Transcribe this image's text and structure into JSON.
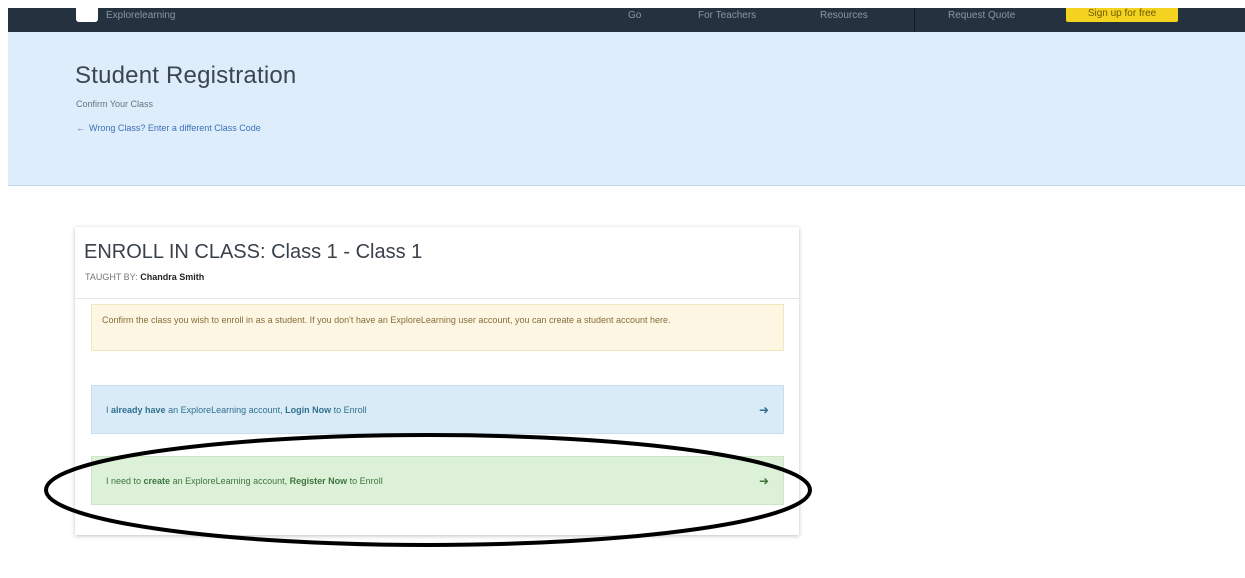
{
  "navbar": {
    "brand": "Explorelearning",
    "items": [
      "Go",
      "For Teachers",
      "Resources"
    ],
    "request_quote": "Request Quote",
    "cta": "Sign up for free"
  },
  "hero": {
    "title": "Student Registration",
    "subtitle": "Confirm Your Class",
    "back_link": "Wrong Class? Enter a different Class Code"
  },
  "card": {
    "title": "ENROLL IN CLASS: Class 1 - Class 1",
    "taught_by_label": "TAUGHT BY:",
    "teacher": "Chandra Smith",
    "notice": "Confirm the class you wish to enroll in as a student. If you don't have an ExploreLearning user account, you can create a student account here.",
    "login_option": {
      "pre": "I ",
      "bold1": "already have",
      "mid": " an ExploreLearning account, ",
      "bold2": "Login Now",
      "post": " to Enroll"
    },
    "register_option": {
      "pre": "I need to ",
      "bold1": "create",
      "mid": " an ExploreLearning account, ",
      "bold2": "Register Now",
      "post": " to Enroll"
    }
  },
  "colors": {
    "navbar": "#243240",
    "hero_bg": "#deedfb",
    "cta_yellow": "#f3d320",
    "info_bg": "#d9ebf7",
    "success_bg": "#ddf0d8",
    "warning_bg": "#fcf6e2"
  }
}
